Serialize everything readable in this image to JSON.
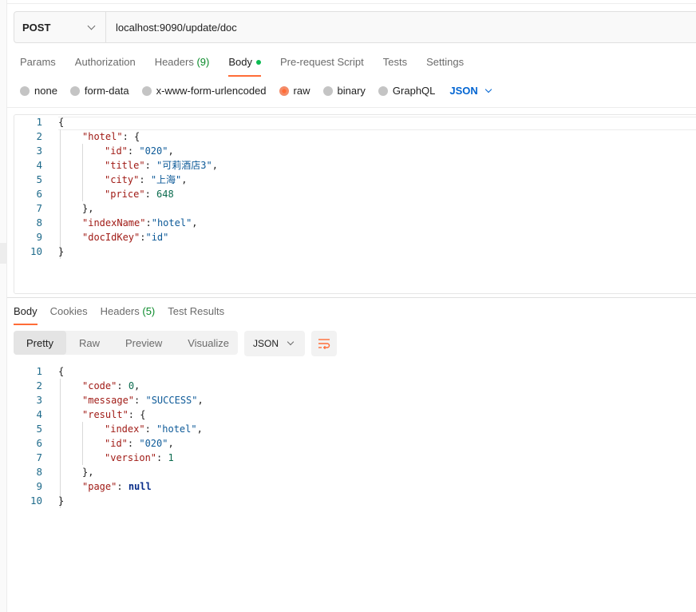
{
  "request": {
    "method": "POST",
    "url": "localhost:9090/update/doc"
  },
  "request_tabs": {
    "params": "Params",
    "authorization": "Authorization",
    "headers": "Headers",
    "headers_count": "(9)",
    "body": "Body",
    "prerequest": "Pre-request Script",
    "tests": "Tests",
    "settings": "Settings"
  },
  "body_types": {
    "none": "none",
    "form_data": "form-data",
    "urlencoded": "x-www-form-urlencoded",
    "raw": "raw",
    "binary": "binary",
    "graphql": "GraphQL",
    "language": "JSON"
  },
  "request_body_lines": [
    {
      "no": "1",
      "text": "{"
    },
    {
      "no": "2",
      "text": "\"hotel\": {"
    },
    {
      "no": "3",
      "text": "\"id\": \"020\","
    },
    {
      "no": "4",
      "text": "\"title\": \"可莉酒店3\","
    },
    {
      "no": "5",
      "text": "\"city\": \"上海\","
    },
    {
      "no": "6",
      "text": "\"price\": 648"
    },
    {
      "no": "7",
      "text": "},"
    },
    {
      "no": "8",
      "text": "\"indexName\":\"hotel\","
    },
    {
      "no": "9",
      "text": "\"docIdKey\":\"id\""
    },
    {
      "no": "10",
      "text": "}"
    }
  ],
  "response_tabs": {
    "body": "Body",
    "cookies": "Cookies",
    "headers": "Headers",
    "headers_count": "(5)",
    "test_results": "Test Results"
  },
  "view_modes": {
    "pretty": "Pretty",
    "raw": "Raw",
    "preview": "Preview",
    "visualize": "Visualize",
    "format": "JSON"
  },
  "response_body_lines": [
    {
      "no": "1",
      "text": "{"
    },
    {
      "no": "2",
      "text": "\"code\": 0,"
    },
    {
      "no": "3",
      "text": "\"message\": \"SUCCESS\","
    },
    {
      "no": "4",
      "text": "\"result\": {"
    },
    {
      "no": "5",
      "text": "\"index\": \"hotel\","
    },
    {
      "no": "6",
      "text": "\"id\": \"020\","
    },
    {
      "no": "7",
      "text": "\"version\": 1"
    },
    {
      "no": "8",
      "text": "},"
    },
    {
      "no": "9",
      "text": "\"page\": null"
    },
    {
      "no": "10",
      "text": "}"
    }
  ],
  "colors": {
    "accent": "#ff6c37",
    "link_blue": "#0265d2",
    "count_green": "#0a8a2a",
    "key_red": "#a01b16",
    "string_blue": "#0d5a98",
    "number_green": "#0b6b4e"
  }
}
